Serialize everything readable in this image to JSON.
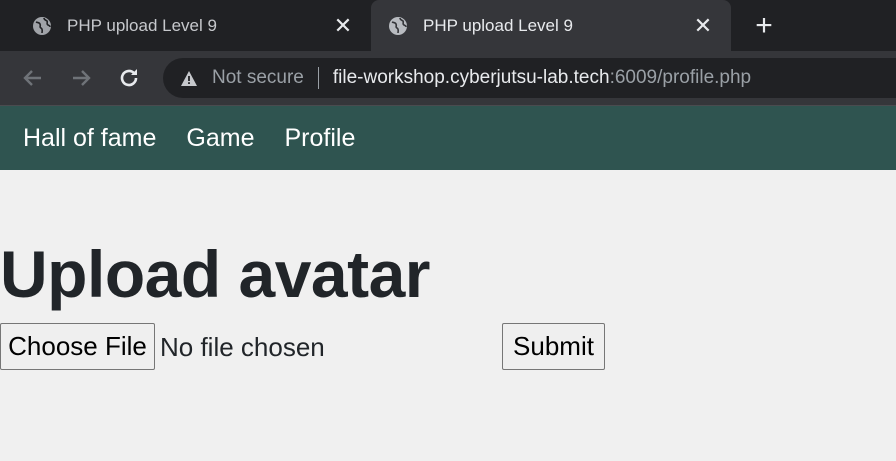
{
  "browser": {
    "tabs": [
      {
        "title": "PHP upload Level 9",
        "active": false
      },
      {
        "title": "PHP upload Level 9",
        "active": true
      }
    ],
    "new_tab_icon": "plus-icon",
    "security_label": "Not secure",
    "url_host": "file-workshop.cyberjutsu-lab.tech",
    "url_rest": ":6009/profile.php"
  },
  "site_nav": {
    "items": [
      "Hall of fame",
      "Game",
      "Profile"
    ],
    "color": "#2f5450"
  },
  "main": {
    "heading": "Upload avatar",
    "choose_file_label": "Choose File",
    "no_file_text": "No file chosen",
    "submit_label": "Submit"
  }
}
